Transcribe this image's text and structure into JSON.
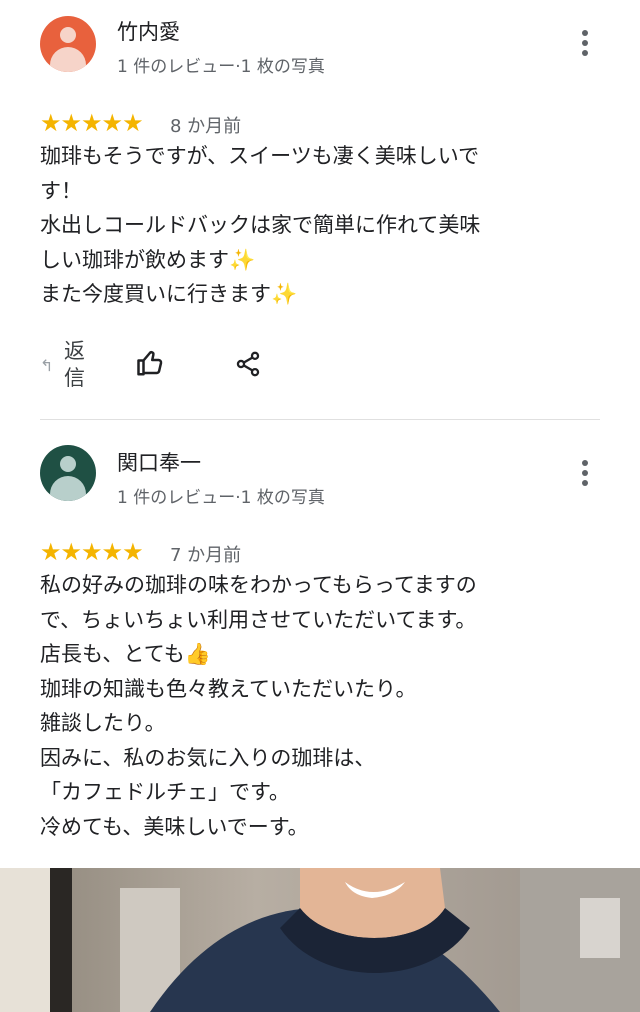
{
  "reviews": [
    {
      "name": "竹内愛",
      "meta": "1 件のレビュー·1 枚の写真",
      "rating": 5,
      "stars": "★★★★★",
      "date": "8 か月前",
      "text": "珈琲もそうですが、スイーツも凄く美味しいで\nす！\n水出しコールドバックは家で簡単に作れて美味\nしい珈琲が飲めます✨\nまた今度買いに行きます✨",
      "reply_label": "返信",
      "avatar_color": "#e8613d"
    },
    {
      "name": "関口奉一",
      "meta": "1 件のレビュー·1 枚の写真",
      "rating": 5,
      "stars": "★★★★★",
      "date": "7 か月前",
      "text": "私の好みの珈琲の味をわかってもらってますの\nで、ちょいちょい利用させていただいてます。\n店長も、とても👍\n珈琲の知識も色々教えていただいたり。\n雑談したり。\n因みに、私のお気に入りの珈琲は、\n「カフェドルチェ」です。\n冷めても、美味しいでーす。",
      "avatar_color": "#1f5044"
    }
  ],
  "icons": {
    "more": "more-vert-icon",
    "reply": "reply-icon",
    "like": "thumb-up-icon",
    "share": "share-icon"
  },
  "colors": {
    "star": "#f4b400",
    "secondary_text": "#5f6368"
  }
}
